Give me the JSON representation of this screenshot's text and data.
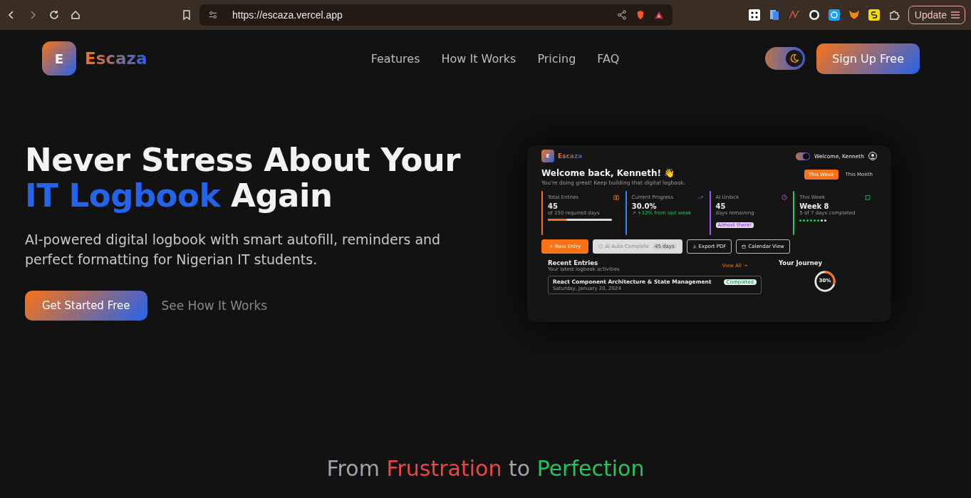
{
  "browser": {
    "url": "https://escaza.vercel.app",
    "update_label": "Update"
  },
  "nav": {
    "logo_letter": "E",
    "brand": "Escaza",
    "links": [
      "Features",
      "How It Works",
      "Pricing",
      "FAQ"
    ],
    "dark_mode": true,
    "cta": "Sign Up Free"
  },
  "hero": {
    "title_line1": "Never Stress About Your",
    "title_highlight": "IT Logbook",
    "title_rest": "Again",
    "subtitle": "AI-powered digital logbook with smart autofill, reminders and perfect formatting for Nigerian IT students.",
    "primary_button": "Get Started Free",
    "secondary_link": "See How It Works"
  },
  "preview": {
    "logo_letter": "E",
    "brand": "Escaza",
    "dark_mode": true,
    "welcome_user": "Welcome, Kenneth",
    "greeting": "Welcome back, Kenneth! 👋",
    "tagline": "You're doing great! Keep building that digital logbook.",
    "periods": [
      {
        "label": "This Week",
        "selected": true
      },
      {
        "label": "This Month",
        "selected": false
      }
    ],
    "stats": [
      {
        "kind": "progress",
        "label": "Total Entries",
        "value": "45",
        "note": "of 150 required days",
        "color": "#f97316",
        "level": 0.3
      },
      {
        "kind": "trend",
        "label": "Current Progress",
        "value": "30.0%",
        "note": "↗ +12% from last week",
        "color": "#3b82f6"
      },
      {
        "kind": "badge",
        "label": "AI Unlock",
        "value": "45",
        "note": "days remaining",
        "badge": "Almost there!",
        "color": "#a855f7"
      },
      {
        "kind": "dots",
        "label": "This Week",
        "value": "Week 8",
        "note": "5 of 7 days completed",
        "color": "#22c55e",
        "days": [
          {
            "done": true
          },
          {
            "done": true
          },
          {
            "done": true
          },
          {
            "done": true
          },
          {
            "done": true
          },
          {
            "done": true
          },
          {
            "done": false
          },
          {
            "done": false
          }
        ]
      }
    ],
    "actions": [
      {
        "kind": "primary",
        "label": "+ New Entry"
      },
      {
        "kind": "locked",
        "label": "AI Auto-Complete",
        "badge": "45 days",
        "disabled": true
      },
      {
        "kind": "export",
        "label": "Export PDF"
      },
      {
        "kind": "calendar",
        "label": "Calendar View"
      }
    ],
    "recent": {
      "title": "Recent Entries",
      "subtitle": "Your latest logbook activities",
      "view_all": "View All →",
      "entries": [
        {
          "title": "React Component Architecture & State Management",
          "status": "Completed",
          "date": "Saturday, January 20, 2024"
        }
      ]
    },
    "journey": {
      "title": "Your Journey",
      "percent": "30%",
      "level": 0.3
    }
  },
  "section_heading": [
    {
      "text": "From",
      "color": "#9ca3af"
    },
    {
      "text": "Frustration",
      "color": "#ef4444"
    },
    {
      "text": "to",
      "color": "#9ca3af"
    },
    {
      "text": "Perfection",
      "color": "#22c55e"
    }
  ]
}
